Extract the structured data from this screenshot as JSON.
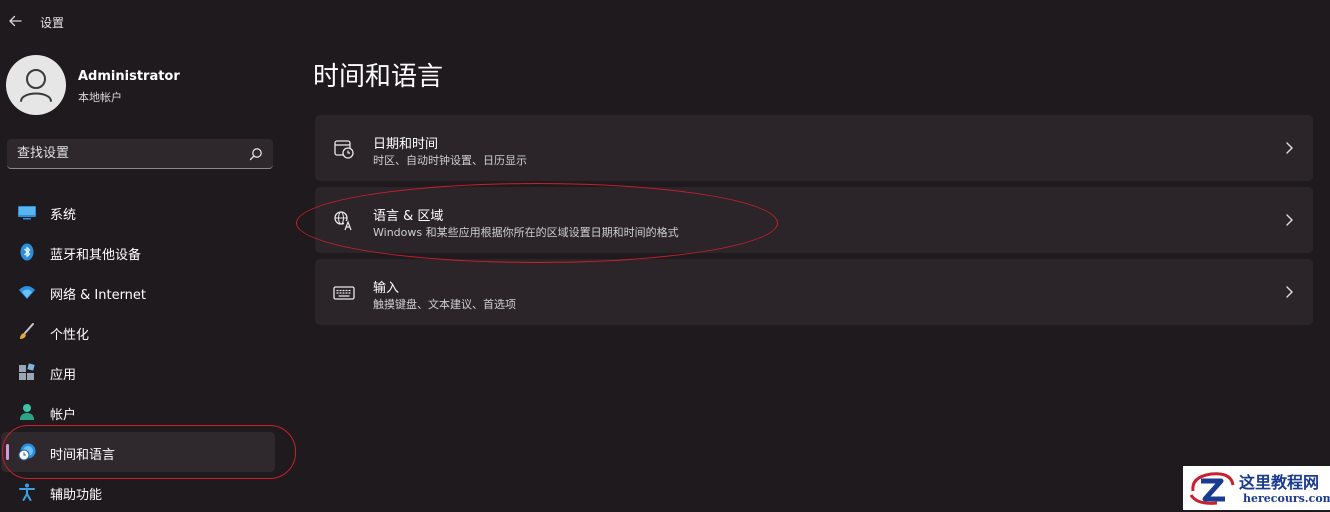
{
  "app": {
    "title": "设置"
  },
  "profile": {
    "name": "Administrator",
    "account_type": "本地帐户"
  },
  "search": {
    "placeholder": "查找设置"
  },
  "sidebar": {
    "items": [
      {
        "label": "系统",
        "icon": "monitor-icon",
        "selected": false
      },
      {
        "label": "蓝牙和其他设备",
        "icon": "bluetooth-icon",
        "selected": false
      },
      {
        "label": "网络 & Internet",
        "icon": "wifi-icon",
        "selected": false
      },
      {
        "label": "个性化",
        "icon": "brush-icon",
        "selected": false
      },
      {
        "label": "应用",
        "icon": "apps-icon",
        "selected": false
      },
      {
        "label": "帐户",
        "icon": "account-icon",
        "selected": false
      },
      {
        "label": "时间和语言",
        "icon": "time-language-icon",
        "selected": true
      },
      {
        "label": "辅助功能",
        "icon": "accessibility-icon",
        "selected": false
      }
    ]
  },
  "main": {
    "title": "时间和语言",
    "cards": [
      {
        "title": "日期和时间",
        "subtitle": "时区、自动时钟设置、日历显示",
        "icon": "calendar-clock-icon"
      },
      {
        "title": "语言 & 区域",
        "subtitle": "Windows 和某些应用根据你所在的区域设置日期和时间的格式",
        "icon": "language-region-icon"
      },
      {
        "title": "输入",
        "subtitle": "触摸键盘、文本建议、首选项",
        "icon": "keyboard-icon"
      }
    ]
  },
  "watermark": {
    "name_cn": "这里教程网",
    "url": "herecours.com"
  },
  "colors": {
    "background": "#1f1a1e",
    "card": "#2b2529",
    "selected_item": "#2f292d",
    "accent": "#d59ad8",
    "annotation": "#c8202c"
  }
}
